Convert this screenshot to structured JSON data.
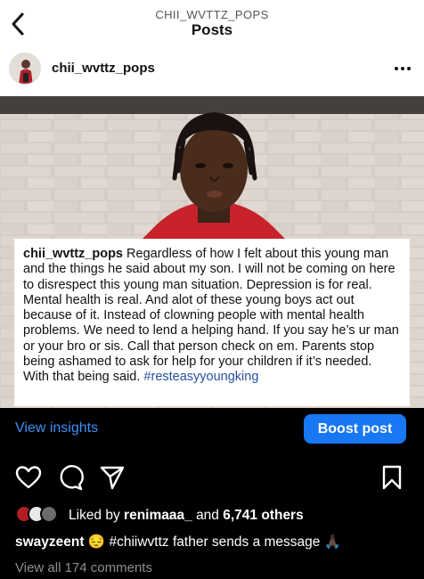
{
  "header": {
    "username": "CHII_WVTTZ_POPS",
    "title": "Posts"
  },
  "post": {
    "author": "chii_wvttz_pops",
    "caption_username": "chii_wvttz_pops",
    "caption_text": "Regardless of how I felt about this young man and the things he said about my son. I will not be coming on here to disrespect this young man situation. Depression is for real. Mental health is real. And alot of these young boys act out because of it. Instead of clowning people with mental health problems. We need to lend a helping hand. If you say he’s ur man or your bro or sis. Call that person check on em. Parents stop being ashamed to ask for help for your children if it’s needed. With that being said.",
    "caption_hashtag": "#resteasyyoungking"
  },
  "insights": {
    "view_label": "View insights",
    "boost_label": "Boost post"
  },
  "likes": {
    "prefix": "Liked by",
    "user": "renimaaa_",
    "middle": "and",
    "others": "6,741 others"
  },
  "comment": {
    "user": "swayzeent",
    "emoji": "😔",
    "text": "#chiiwvttz father sends a message",
    "emoji_end": "🙏🏿"
  },
  "view_all_comments": "View all 174 comments",
  "icons": [
    "back-chevron-icon",
    "more-options-icon",
    "heart-icon",
    "comment-icon",
    "share-icon",
    "bookmark-icon"
  ],
  "colors": {
    "link_blue": "#3f8ff7",
    "boost_blue": "#1877f2",
    "hashtag_blue": "#2a4ea3"
  }
}
